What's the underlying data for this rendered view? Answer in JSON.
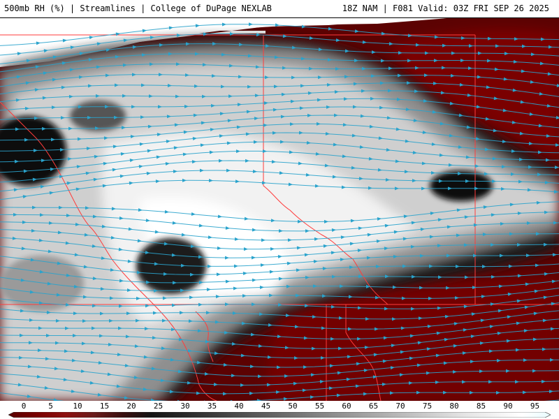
{
  "header": {
    "left": "500mb RH (%) | Streamlines | College of DuPage NEXLAB",
    "right": "18Z NAM | F081 Valid: 03Z FRI SEP 26 2025"
  },
  "map": {
    "field": "500mb relative humidity (%)",
    "overlay": "streamlines",
    "borders_color": "#ff3b3b",
    "streamline_color": "#2aa3cc"
  },
  "colorbar": {
    "ticks": [
      "0",
      "5",
      "10",
      "15",
      "20",
      "25",
      "30",
      "35",
      "40",
      "45",
      "50",
      "55",
      "60",
      "65",
      "70",
      "75",
      "80",
      "85",
      "90",
      "95"
    ],
    "colors": [
      "#5a0000",
      "#7a0000",
      "#8e1010",
      "#6a1c1c",
      "#3a0f0f",
      "#141414",
      "#262626",
      "#393939",
      "#4c4c4c",
      "#5f5f5f",
      "#727272",
      "#868686",
      "#999999",
      "#acacac",
      "#bfbfbf",
      "#d2d2d2",
      "#e5e5e5",
      "#f2f2f2",
      "#ffffff",
      "#e8fbff"
    ]
  }
}
